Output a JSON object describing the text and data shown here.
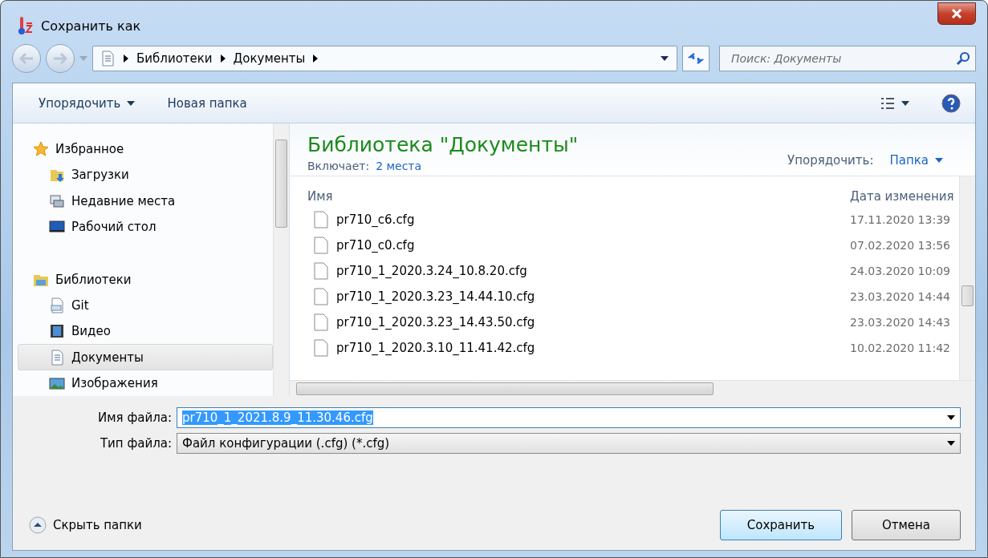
{
  "window": {
    "title": "Сохранить как"
  },
  "breadcrumb": [
    "Библиотеки",
    "Документы"
  ],
  "search": {
    "placeholder": "Поиск: Документы"
  },
  "toolbar": {
    "organize": "Упорядочить",
    "new_folder": "Новая папка"
  },
  "sidebar": {
    "groups": [
      {
        "label": "Избранное",
        "kind": "star",
        "children": [
          {
            "label": "Загрузки",
            "kind": "downloads",
            "selected": false
          },
          {
            "label": "Недавние места",
            "kind": "recent",
            "selected": false
          },
          {
            "label": "Рабочий стол",
            "kind": "desktop",
            "selected": false
          }
        ]
      },
      {
        "label": "Библиотеки",
        "kind": "library",
        "children": [
          {
            "label": "Git",
            "kind": "git",
            "selected": false
          },
          {
            "label": "Видео",
            "kind": "video",
            "selected": false
          },
          {
            "label": "Документы",
            "kind": "doc",
            "selected": true
          },
          {
            "label": "Изображения",
            "kind": "image",
            "selected": false
          }
        ]
      }
    ]
  },
  "library": {
    "title": "Библиотека \"Документы\"",
    "includes_label": "Включает:",
    "includes_link": "2 места",
    "arrange_label": "Упорядочить:",
    "arrange_value": "Папка"
  },
  "table": {
    "columns": [
      "Имя",
      "Дата изменения"
    ],
    "rows": [
      {
        "name": "pr710_c6.cfg",
        "date": "17.11.2020 13:39"
      },
      {
        "name": "pr710_c0.cfg",
        "date": "07.02.2020 13:56"
      },
      {
        "name": "pr710_1_2020.3.24_10.8.20.cfg",
        "date": "24.03.2020 10:09"
      },
      {
        "name": "pr710_1_2020.3.23_14.44.10.cfg",
        "date": "23.03.2020 14:44"
      },
      {
        "name": "pr710_1_2020.3.23_14.43.50.cfg",
        "date": "23.03.2020 14:43"
      },
      {
        "name": "pr710_1_2020.3.10_11.41.42.cfg",
        "date": "10.02.2020 11:42"
      }
    ]
  },
  "form": {
    "filename_label": "Имя файла:",
    "filename": "pr710_1_2021.8.9_11.30.46.cfg",
    "filetype_label": "Тип файла:",
    "filetype": "Файл конфигурации (.cfg) (*.cfg)"
  },
  "hide_folders": "Скрыть папки",
  "buttons": [
    {
      "label": "Сохранить",
      "kind": "default"
    },
    {
      "label": "Отмена",
      "kind": "normal"
    }
  ]
}
